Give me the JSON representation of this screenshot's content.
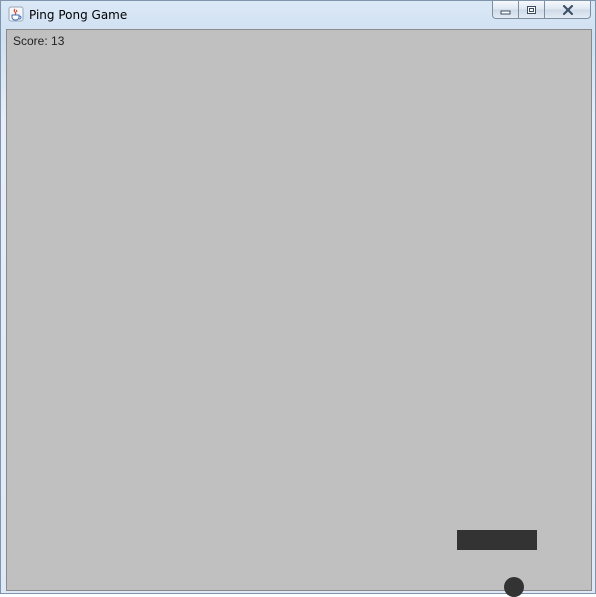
{
  "window": {
    "title": "Ping Pong Game",
    "app_icon": "java-cup-icon",
    "controls": {
      "minimize_icon": "minimize-icon",
      "maximize_icon": "restore-icon",
      "close_icon": "close-icon"
    }
  },
  "game": {
    "score_text": "Score: 13",
    "background_color": "#c0c0c0",
    "paddle_color": "#333333",
    "ball_color": "#333333"
  }
}
